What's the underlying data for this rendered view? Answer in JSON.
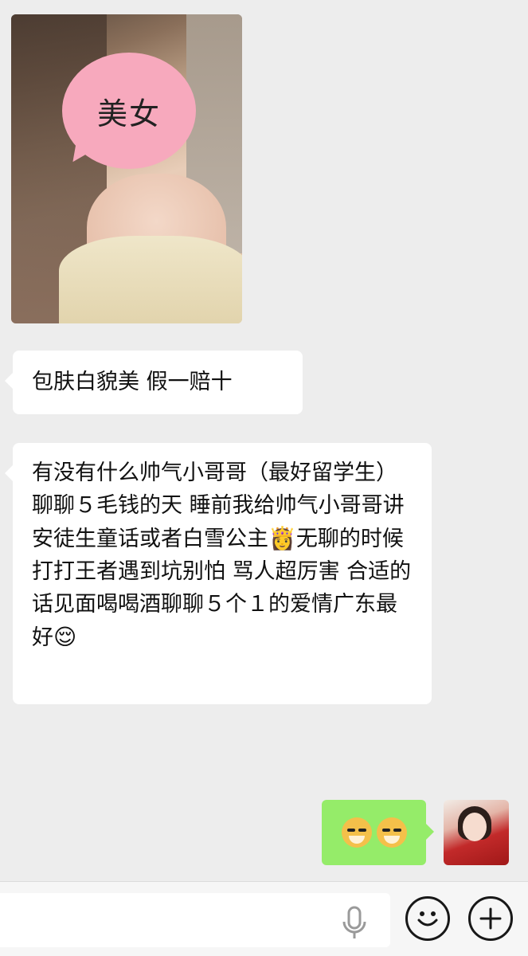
{
  "messages": {
    "image_sticker_text": "美女",
    "text1": "包肤白貌美 假一赔十",
    "text2_parts": {
      "before_princess": "有没有什么帅气小哥哥（最好留学生）聊聊５毛钱的天 睡前我给帅气小哥哥讲安徒生童话或者白雪公主",
      "after_princess": "无聊的时候打打王者遇到坑别怕 骂人超厉害 合适的话见面喝喝酒聊聊５个１的爱情广东最好"
    },
    "emoji_icons": [
      "princess-emoji",
      "smirk-emoji"
    ],
    "sent_sticker": [
      "doge-emoji",
      "doge-emoji"
    ]
  },
  "input_bar": {
    "value": "",
    "placeholder": ""
  },
  "colors": {
    "chat_background": "#ededed",
    "incoming_bubble": "#ffffff",
    "outgoing_bubble": "#95ec69",
    "sticker_pink": "#f7a9bd"
  }
}
